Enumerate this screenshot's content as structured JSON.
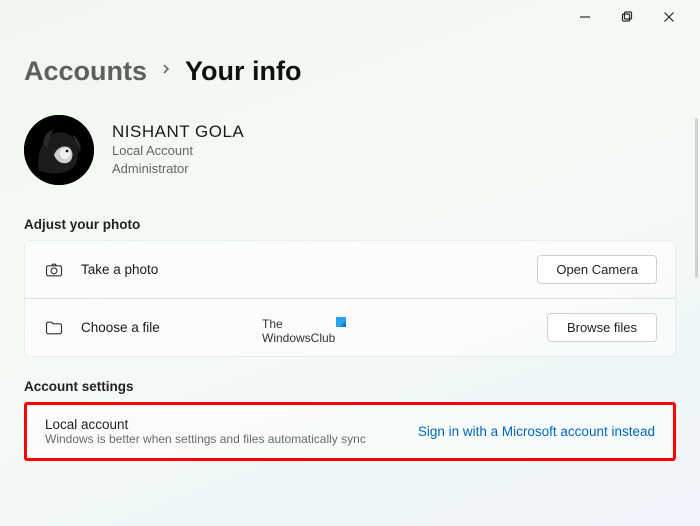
{
  "window": {
    "minimize_tip": "Minimize",
    "maximize_tip": "Restore",
    "close_tip": "Close"
  },
  "breadcrumb": {
    "parent": "Accounts",
    "current": "Your info"
  },
  "user": {
    "name": "NISHANT GOLA",
    "type": "Local Account",
    "role": "Administrator"
  },
  "photo_section": {
    "title": "Adjust your photo",
    "rows": [
      {
        "label": "Take a photo",
        "button": "Open Camera"
      },
      {
        "label": "Choose a file",
        "button": "Browse files"
      }
    ]
  },
  "account_section": {
    "title": "Account settings",
    "local": {
      "title": "Local account",
      "subtitle": "Windows is better when settings and files automatically sync",
      "link": "Sign in with a Microsoft account instead"
    }
  },
  "watermark": {
    "line1": "The",
    "line2": "WindowsClub"
  }
}
